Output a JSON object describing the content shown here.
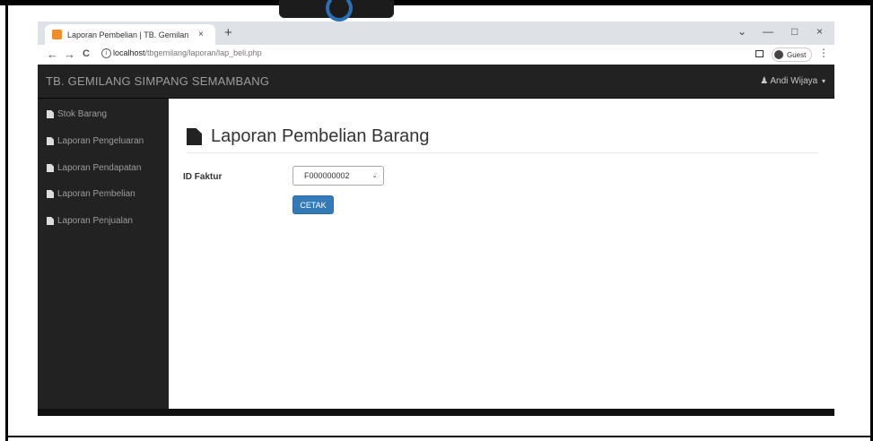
{
  "browser": {
    "tab_title": "Laporan Pembelian | TB. Gemilan",
    "tab_close": "×",
    "new_tab": "+",
    "url_host": "localhost",
    "url_path": "/tbgemilang/laporan/lap_beli.php",
    "guest_label": "Guest",
    "minimize": "—",
    "maximize": "□",
    "close": "×",
    "dropdown": "⌄",
    "back": "←",
    "forward": "→",
    "reload": "C",
    "menu": "⋮"
  },
  "navbar": {
    "brand": "TB. GEMILANG SIMPANG SEMAMBANG",
    "user": "Andi Wijaya",
    "user_icon": "user-icon"
  },
  "sidebar": {
    "items": [
      {
        "label": "Stok Barang",
        "icon": "file-icon"
      },
      {
        "label": "Laporan Pengeluaran",
        "icon": "file-icon"
      },
      {
        "label": "Laporan Pendapatan",
        "icon": "file-icon"
      },
      {
        "label": "Laporan Pembelian",
        "icon": "file-icon"
      },
      {
        "label": "Laporan Penjualan",
        "icon": "file-icon"
      }
    ]
  },
  "main": {
    "title": "Laporan Pembelian Barang",
    "field_label": "ID Faktur",
    "selected_faktur": "F000000002",
    "print_button": "CETAK"
  },
  "colors": {
    "navbar_bg": "#222222",
    "button_primary": "#337ab7"
  }
}
